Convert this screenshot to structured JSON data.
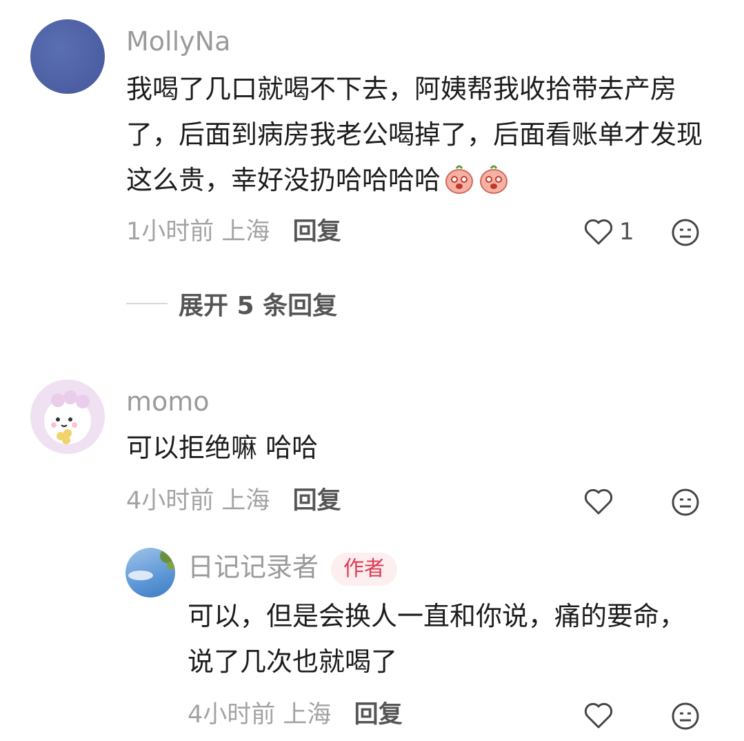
{
  "comments": [
    {
      "username": "MollyNa",
      "text": "我喝了几口就喝不下去，阿姨帮我收拾带去产房了，后面到病房我老公喝掉了，后面看账单才发现这么贵，幸好没扔哈哈哈哈",
      "time": "1小时前",
      "location": "上海",
      "reply_label": "回复",
      "like_count": "1",
      "expand_label": "展开 5 条回复"
    },
    {
      "username": "momo",
      "text": "可以拒绝嘛 哈哈",
      "time": "4小时前",
      "location": "上海",
      "reply_label": "回复"
    },
    {
      "username": "日记记录者",
      "badge": "作者",
      "text": "可以，但是会换人一直和你说，痛的要命，说了几次也就喝了",
      "time": "4小时前",
      "location": "上海",
      "reply_label": "回复"
    }
  ],
  "icons": {
    "like": "heart-outline-icon",
    "dislike": "neutral-face-icon",
    "emoji": "peach-laughing-emoji"
  },
  "colors": {
    "badge_bg": "#fdeef0",
    "badge_text": "#e03a52",
    "meta_text": "#a3a3a3"
  }
}
